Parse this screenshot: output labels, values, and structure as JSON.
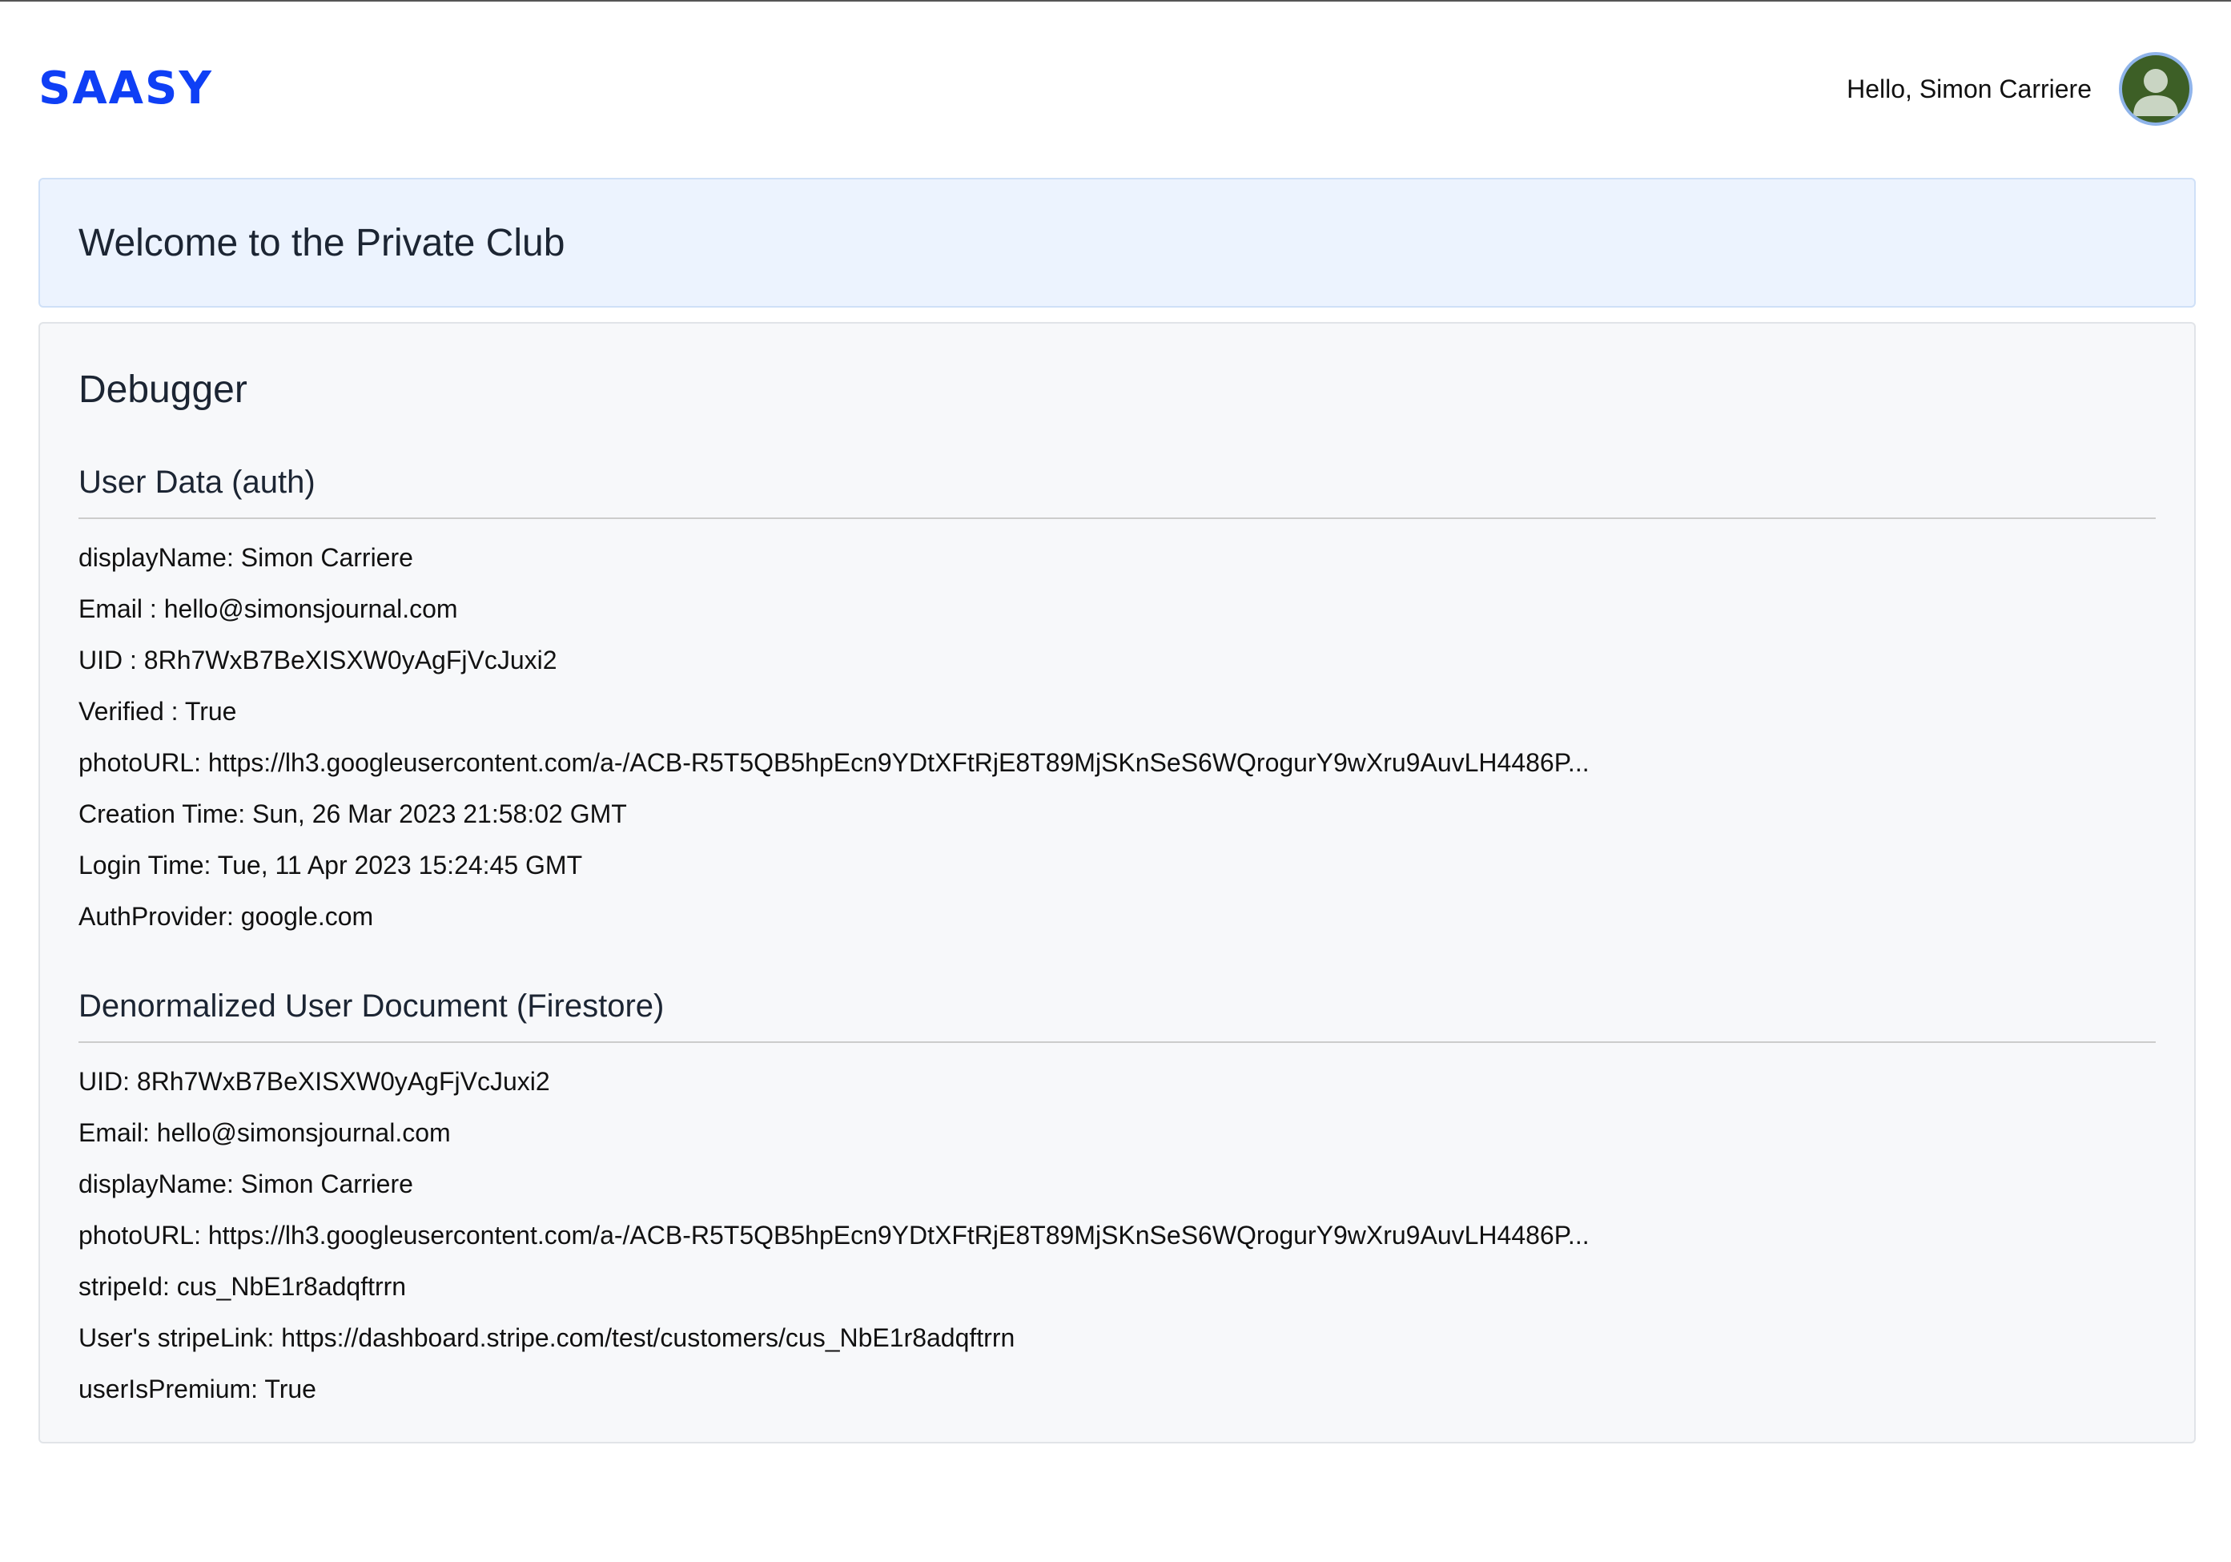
{
  "header": {
    "logo": "SAASY",
    "greeting": "Hello, Simon Carriere",
    "avatar_icon": "user-avatar-icon"
  },
  "welcome": {
    "title": "Welcome to the Private Club"
  },
  "debugger": {
    "title": "Debugger",
    "auth_section": {
      "title": "User Data (auth)",
      "rows": [
        "displayName: Simon Carriere",
        "Email : hello@simonsjournal.com",
        "UID : 8Rh7WxB7BeXISXW0yAgFjVcJuxi2",
        "Verified : True",
        "photoURL: https://lh3.googleusercontent.com/a-/ACB-R5T5QB5hpEcn9YDtXFtRjE8T89MjSKnSeS6WQrogurY9wXru9AuvLH4486P...",
        "Creation Time: Sun, 26 Mar 2023 21:58:02 GMT",
        "Login Time: Tue, 11 Apr 2023 15:24:45 GMT",
        "AuthProvider: google.com"
      ]
    },
    "firestore_section": {
      "title": "Denormalized User Document (Firestore)",
      "rows": [
        "UID: 8Rh7WxB7BeXISXW0yAgFjVcJuxi2",
        "Email: hello@simonsjournal.com",
        "displayName: Simon Carriere",
        "photoURL: https://lh3.googleusercontent.com/a-/ACB-R5T5QB5hpEcn9YDtXFtRjE8T89MjSKnSeS6WQrogurY9wXru9AuvLH4486P...",
        "stripeId: cus_NbE1r8adqftrrn",
        "User's stripeLink: https://dashboard.stripe.com/test/customers/cus_NbE1r8adqftrrn",
        "userIsPremium: True"
      ]
    }
  }
}
